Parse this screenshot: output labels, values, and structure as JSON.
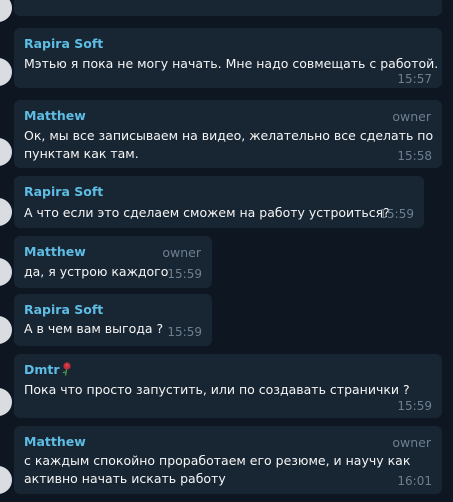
{
  "chat": {
    "messages": [
      {
        "sender": "Rapira Soft",
        "role": "",
        "lines": [
          "Мэтью я пока не могу начать. Мне надо совмещать с работой."
        ],
        "time": "15:57"
      },
      {
        "sender": "Matthew",
        "role": "owner",
        "lines": [
          "Ок, мы все записываем на видео, желательно все сделать по",
          "пунктам как там."
        ],
        "time": "15:58"
      },
      {
        "sender": "Rapira Soft",
        "role": "",
        "lines": [
          "А что если это сделаем сможем на работу устроиться?"
        ],
        "time": "15:59"
      },
      {
        "sender": "Matthew",
        "role": "owner",
        "lines": [
          "да, я устрою каждого"
        ],
        "time": "15:59"
      },
      {
        "sender": "Rapira Soft",
        "role": "",
        "lines": [
          "А в чем вам выгода ?"
        ],
        "time": "15:59"
      },
      {
        "sender": "Dmtr",
        "sender_icon": "rose-icon",
        "role": "",
        "lines": [
          "Пока что просто запустить, или по создавать странички ?"
        ],
        "time": "15:59"
      },
      {
        "sender": "Matthew",
        "role": "owner",
        "lines": [
          "с каждым спокойно проработаем его резюме, и научу как",
          "активно начать искать работу"
        ],
        "time": "16:01"
      }
    ]
  },
  "colors": {
    "background": "#0e1621",
    "bubble": "#182533",
    "sender_name": "#5ebde4",
    "message_text": "#f5f5f5",
    "meta_text": "#6d7f8f"
  }
}
